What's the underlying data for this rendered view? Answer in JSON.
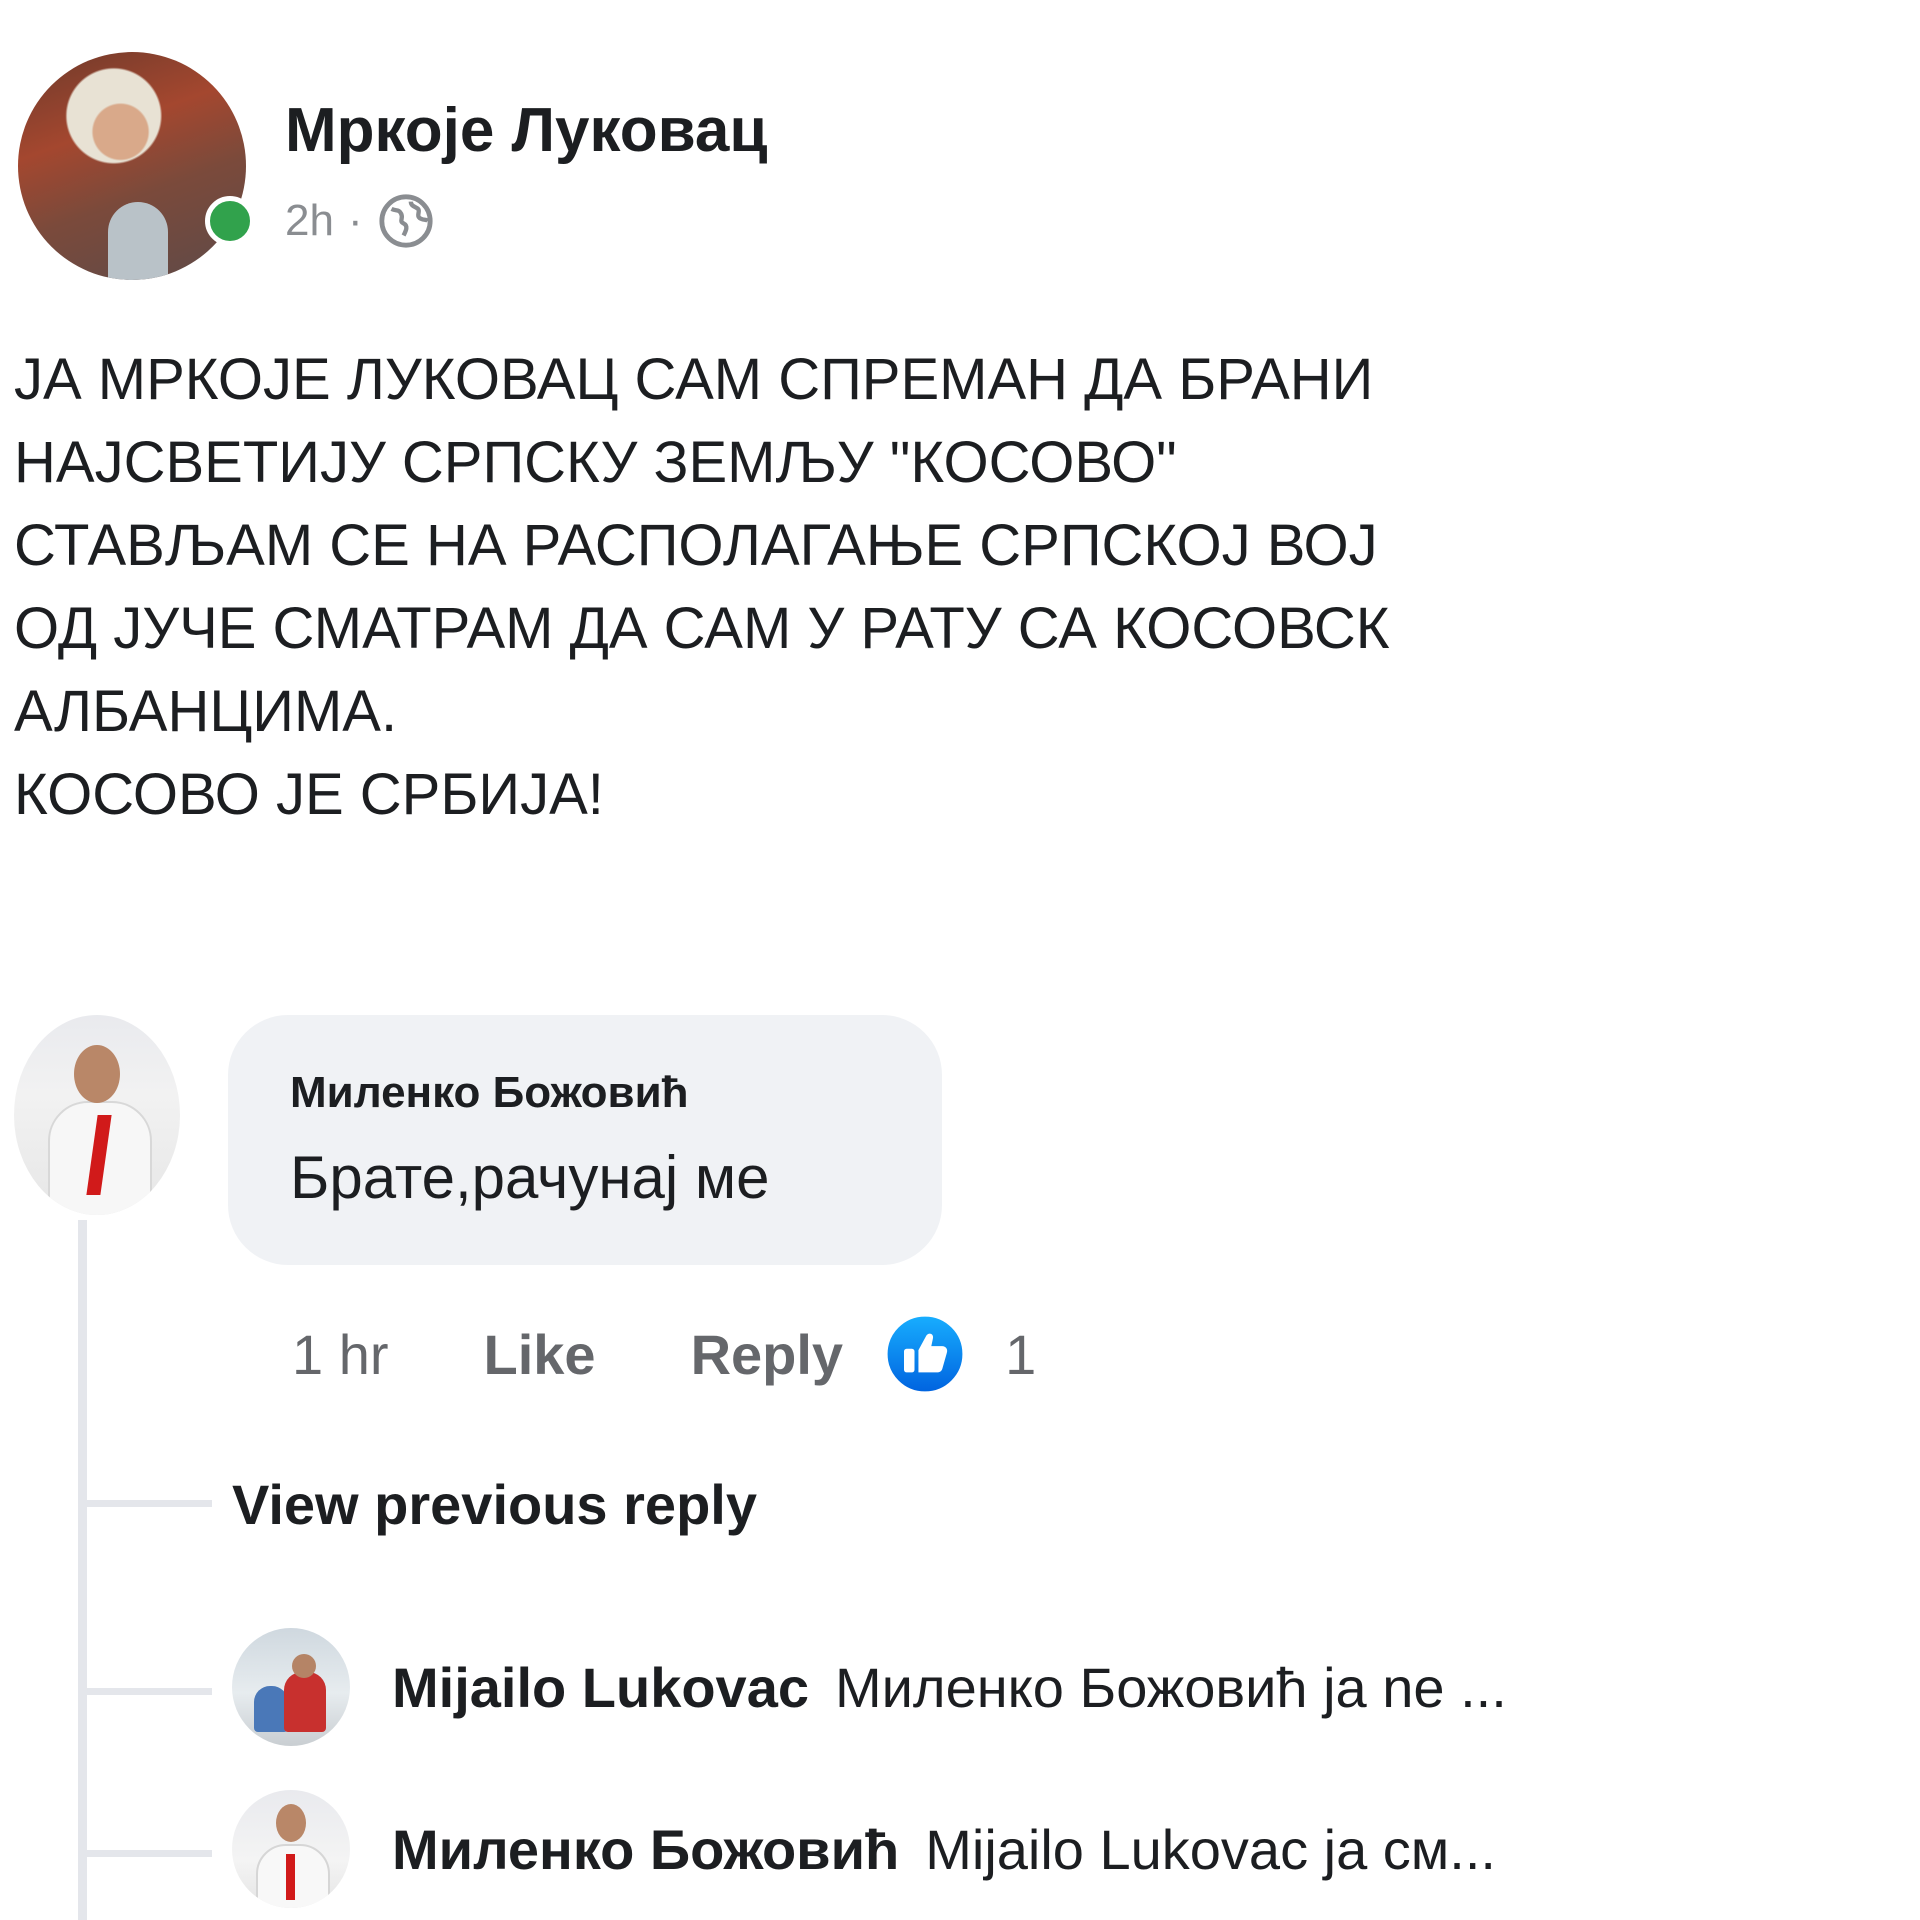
{
  "post": {
    "author": "Мркоје Луковац",
    "time": "2h",
    "separator": "·",
    "audience_icon": "globe-icon",
    "body": "ЈА МРКОЈЕ ЛУКОВАЦ САМ СПРЕМАН ДА БРАНИ\nНАЈСВЕТИЈУ СРПСКУ ЗЕМЉУ \"КОСОВО\"\nСТАВЉАМ СЕ НА РАСПОЛАГАЊЕ СРПСКОЈ ВОЈ\nОД ЈУЧЕ СМАТРАМ ДА САМ У РАТУ СА КОСОВСК\nАЛБАНЦИМА.\nКОСОВО ЈЕ СРБИЈА!"
  },
  "comment": {
    "author": "Миленко Божовић",
    "text": "Брате,рачунај ме",
    "time": "1 hr",
    "like_label": "Like",
    "reply_label": "Reply",
    "reaction_icon": "thumbs-up-icon",
    "reaction_count": "1"
  },
  "view_previous_label": "View previous reply",
  "replies": [
    {
      "author": "Mijailo Lukovac",
      "text": "Миленко Божовић ја ne ..."
    },
    {
      "author": "Миленко Божовић",
      "text": "Mijailo Lukovac ја см..."
    }
  ],
  "colors": {
    "online": "#31a24c",
    "like_blue": "#1877f2",
    "bubble": "#f0f2f5",
    "muted_text": "#65676b"
  }
}
